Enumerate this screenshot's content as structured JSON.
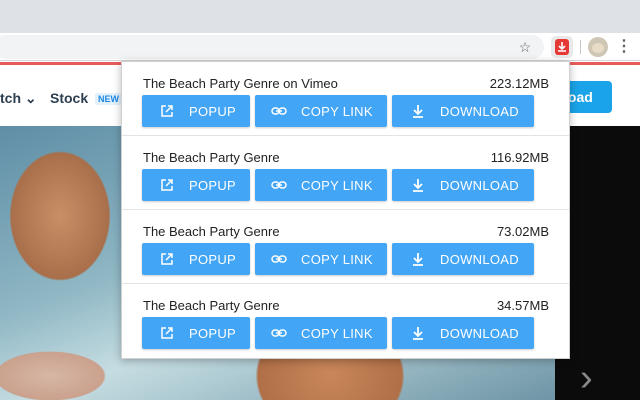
{
  "browser": {
    "icons": {
      "star": "star-icon",
      "extension": "download-extension-icon",
      "avatar": "profile-avatar",
      "menu": "more-vert-icon"
    }
  },
  "site": {
    "nav_watch": "tch",
    "nav_stock": "Stock",
    "new_badge": "NEW",
    "upload_label": "load"
  },
  "popup": {
    "rows": [
      {
        "title": "The Beach Party Genre on Vimeo",
        "size": "223.12MB",
        "popup_label": "POPUP",
        "copy_label": "COPY LINK",
        "download_label": "DOWNLOAD"
      },
      {
        "title": "The Beach Party Genre",
        "size": "116.92MB",
        "popup_label": "POPUP",
        "copy_label": "COPY LINK",
        "download_label": "DOWNLOAD"
      },
      {
        "title": "The Beach Party Genre",
        "size": "73.02MB",
        "popup_label": "POPUP",
        "copy_label": "COPY LINK",
        "download_label": "DOWNLOAD"
      },
      {
        "title": "The Beach Party Genre",
        "size": "34.57MB",
        "popup_label": "POPUP",
        "copy_label": "COPY LINK",
        "download_label": "DOWNLOAD"
      }
    ]
  },
  "colors": {
    "button": "#42a5f5",
    "accent_red": "#e53935",
    "upload": "#1aa3e8"
  }
}
